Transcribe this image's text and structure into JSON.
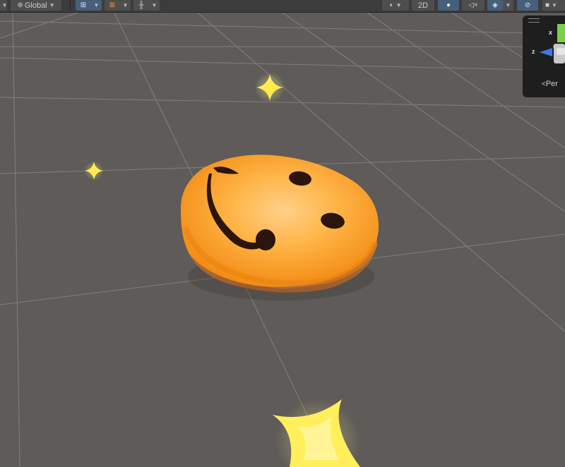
{
  "toolbar": {
    "pivot_rotation_label": "Global",
    "toggle_2d_label": "2D"
  },
  "icons": {
    "global": "globe-icon",
    "grid_snap": "grid-snap-icon",
    "increment_snap": "increment-snap-icon",
    "ruler": "ruler-icon",
    "shading": "shading-mode-icon",
    "lighting": "lightbulb-icon",
    "audio": "audio-mute-icon",
    "effects": "scene-effects-icon",
    "visibility": "scene-visibility-icon",
    "camera": "camera-icon"
  },
  "gizmo": {
    "x_label": "x",
    "z_label": "z",
    "projection_label": "Per"
  },
  "colors": {
    "viewport_bg": "#5e5b58",
    "grid_line": "#7d7a77",
    "toolbar_bg": "#3c3c3c",
    "active_button": "#46607c",
    "sparkle": "#ffeb4d",
    "icing_orange": "#ff9f1e",
    "face_ink": "#2b150c"
  }
}
